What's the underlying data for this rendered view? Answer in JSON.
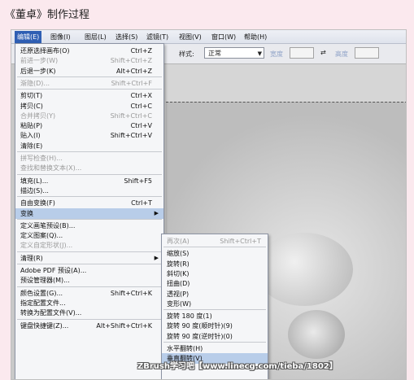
{
  "heading": "《董卓》制作过程",
  "menubar": {
    "items": [
      "编辑(E)",
      "图像(I)",
      "图层(L)",
      "选择(S)",
      "滤镜(T)",
      "视图(V)",
      "窗口(W)",
      "帮助(H)"
    ]
  },
  "options_bar": {
    "style_label": "样式:",
    "style_value": "正常",
    "width_label": "宽度",
    "height_label": "高度",
    "swap_icon": "⇄"
  },
  "edit_menu": [
    {
      "label": "还原选择画布(O)",
      "shortcut": "Ctrl+Z",
      "disabled": false
    },
    {
      "label": "前进一步(W)",
      "shortcut": "Shift+Ctrl+Z",
      "disabled": true
    },
    {
      "label": "后退一步(K)",
      "shortcut": "Alt+Ctrl+Z",
      "disabled": false
    },
    {
      "separator": true
    },
    {
      "label": "渐隐(D)...",
      "shortcut": "Shift+Ctrl+F",
      "disabled": true
    },
    {
      "separator": true
    },
    {
      "label": "剪切(T)",
      "shortcut": "Ctrl+X",
      "disabled": false
    },
    {
      "label": "拷贝(C)",
      "shortcut": "Ctrl+C",
      "disabled": false
    },
    {
      "label": "合并拷贝(Y)",
      "shortcut": "Shift+Ctrl+C",
      "disabled": true
    },
    {
      "label": "粘贴(P)",
      "shortcut": "Ctrl+V",
      "disabled": false
    },
    {
      "label": "贴入(I)",
      "shortcut": "Shift+Ctrl+V",
      "disabled": false
    },
    {
      "label": "清除(E)",
      "shortcut": "",
      "disabled": false
    },
    {
      "separator": true
    },
    {
      "label": "拼写检查(H)...",
      "shortcut": "",
      "disabled": true
    },
    {
      "label": "查找和替换文本(X)...",
      "shortcut": "",
      "disabled": true
    },
    {
      "separator": true
    },
    {
      "label": "填充(L)...",
      "shortcut": "Shift+F5",
      "disabled": false
    },
    {
      "label": "描边(S)...",
      "shortcut": "",
      "disabled": false
    },
    {
      "separator": true
    },
    {
      "label": "自由变换(F)",
      "shortcut": "Ctrl+T",
      "disabled": false
    },
    {
      "label": "变换",
      "shortcut": "",
      "disabled": false,
      "highlight": true,
      "submenu": true
    },
    {
      "separator": true
    },
    {
      "label": "定义画笔预设(B)...",
      "shortcut": "",
      "disabled": false
    },
    {
      "label": "定义图案(Q)...",
      "shortcut": "",
      "disabled": false
    },
    {
      "label": "定义自定形状(J)...",
      "shortcut": "",
      "disabled": true
    },
    {
      "separator": true
    },
    {
      "label": "清理(R)",
      "shortcut": "",
      "disabled": false,
      "submenu": true
    },
    {
      "separator": true
    },
    {
      "label": "Adobe PDF 预设(A)...",
      "shortcut": "",
      "disabled": false
    },
    {
      "label": "预设管理器(M)...",
      "shortcut": "",
      "disabled": false
    },
    {
      "separator": true
    },
    {
      "label": "颜色设置(G)...",
      "shortcut": "Shift+Ctrl+K",
      "disabled": false
    },
    {
      "label": "指定配置文件...",
      "shortcut": "",
      "disabled": false
    },
    {
      "label": "转换为配置文件(V)...",
      "shortcut": "",
      "disabled": false
    },
    {
      "separator": true
    },
    {
      "label": "键盘快捷键(Z)...",
      "shortcut": "Alt+Shift+Ctrl+K",
      "disabled": false
    }
  ],
  "transform_submenu": [
    {
      "label": "再次(A)",
      "shortcut": "Shift+Ctrl+T",
      "disabled": true
    },
    {
      "separator": true
    },
    {
      "label": "缩放(S)",
      "shortcut": "",
      "disabled": false
    },
    {
      "label": "旋转(R)",
      "shortcut": "",
      "disabled": false
    },
    {
      "label": "斜切(K)",
      "shortcut": "",
      "disabled": false
    },
    {
      "label": "扭曲(D)",
      "shortcut": "",
      "disabled": false
    },
    {
      "label": "透视(P)",
      "shortcut": "",
      "disabled": false
    },
    {
      "label": "变形(W)",
      "shortcut": "",
      "disabled": false
    },
    {
      "separator": true
    },
    {
      "label": "旋转 180 度(1)",
      "shortcut": "",
      "disabled": false
    },
    {
      "label": "旋转 90 度(顺时针)(9)",
      "shortcut": "",
      "disabled": false
    },
    {
      "label": "旋转 90 度(逆时针)(0)",
      "shortcut": "",
      "disabled": false
    },
    {
      "separator": true
    },
    {
      "label": "水平翻转(H)",
      "shortcut": "",
      "disabled": false
    },
    {
      "label": "垂直翻转(V)",
      "shortcut": "",
      "disabled": false,
      "highlight": true
    }
  ],
  "watermark": "ZBrush学习吧【www.linecg.com/tieba/1802】"
}
